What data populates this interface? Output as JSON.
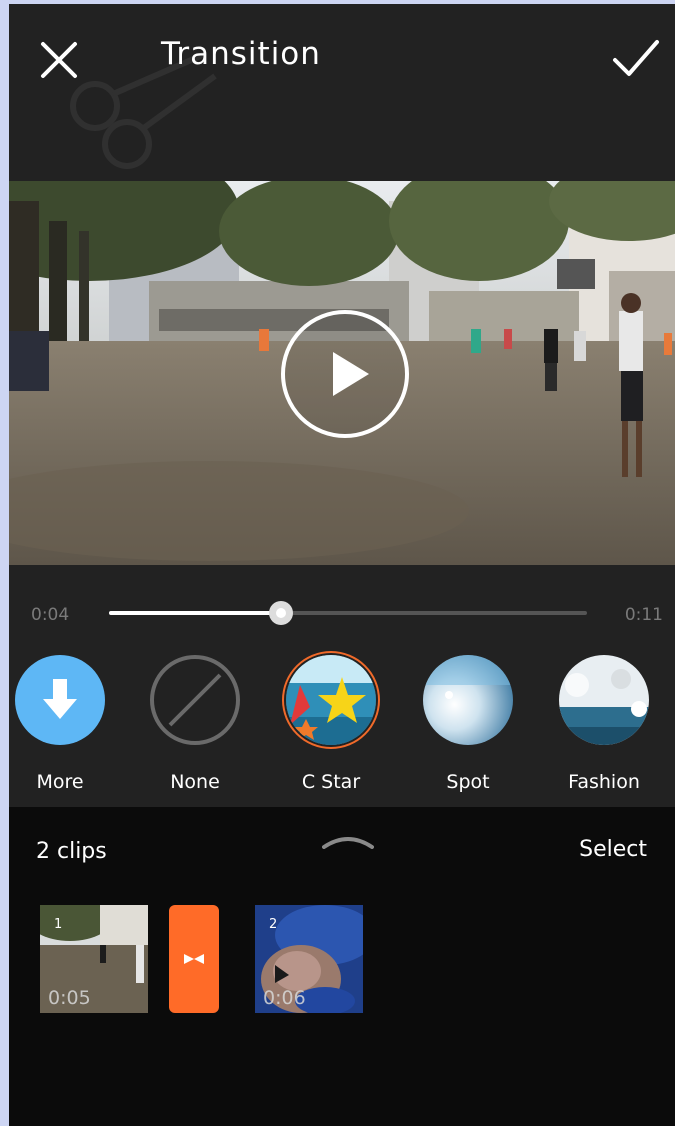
{
  "header": {
    "title": "Transition",
    "close_icon": "close-icon",
    "confirm_icon": "check-icon"
  },
  "player": {
    "play_icon": "play-icon",
    "current_time": "0:04",
    "total_time": "0:11",
    "progress_fraction": 0.36
  },
  "effects": [
    {
      "label": "More",
      "icon": "download-icon"
    },
    {
      "label": "None",
      "icon": "no-effect-icon"
    },
    {
      "label": "C Star",
      "icon": "star-thumbnail",
      "selected": true
    },
    {
      "label": "Spot",
      "icon": "spot-thumbnail"
    },
    {
      "label": "Fashion",
      "icon": "fashion-thumbnail"
    }
  ],
  "clips_panel": {
    "count_label": "2 clips",
    "select_label": "Select",
    "clips": [
      {
        "index": "1",
        "duration": "0:05"
      },
      {
        "index": "2",
        "duration": "0:06"
      }
    ],
    "transition_icon": "bowtie-transition-icon"
  },
  "colors": {
    "accent": "#ff6b28",
    "more_blue": "#5eb7f5",
    "background": "#222222"
  }
}
